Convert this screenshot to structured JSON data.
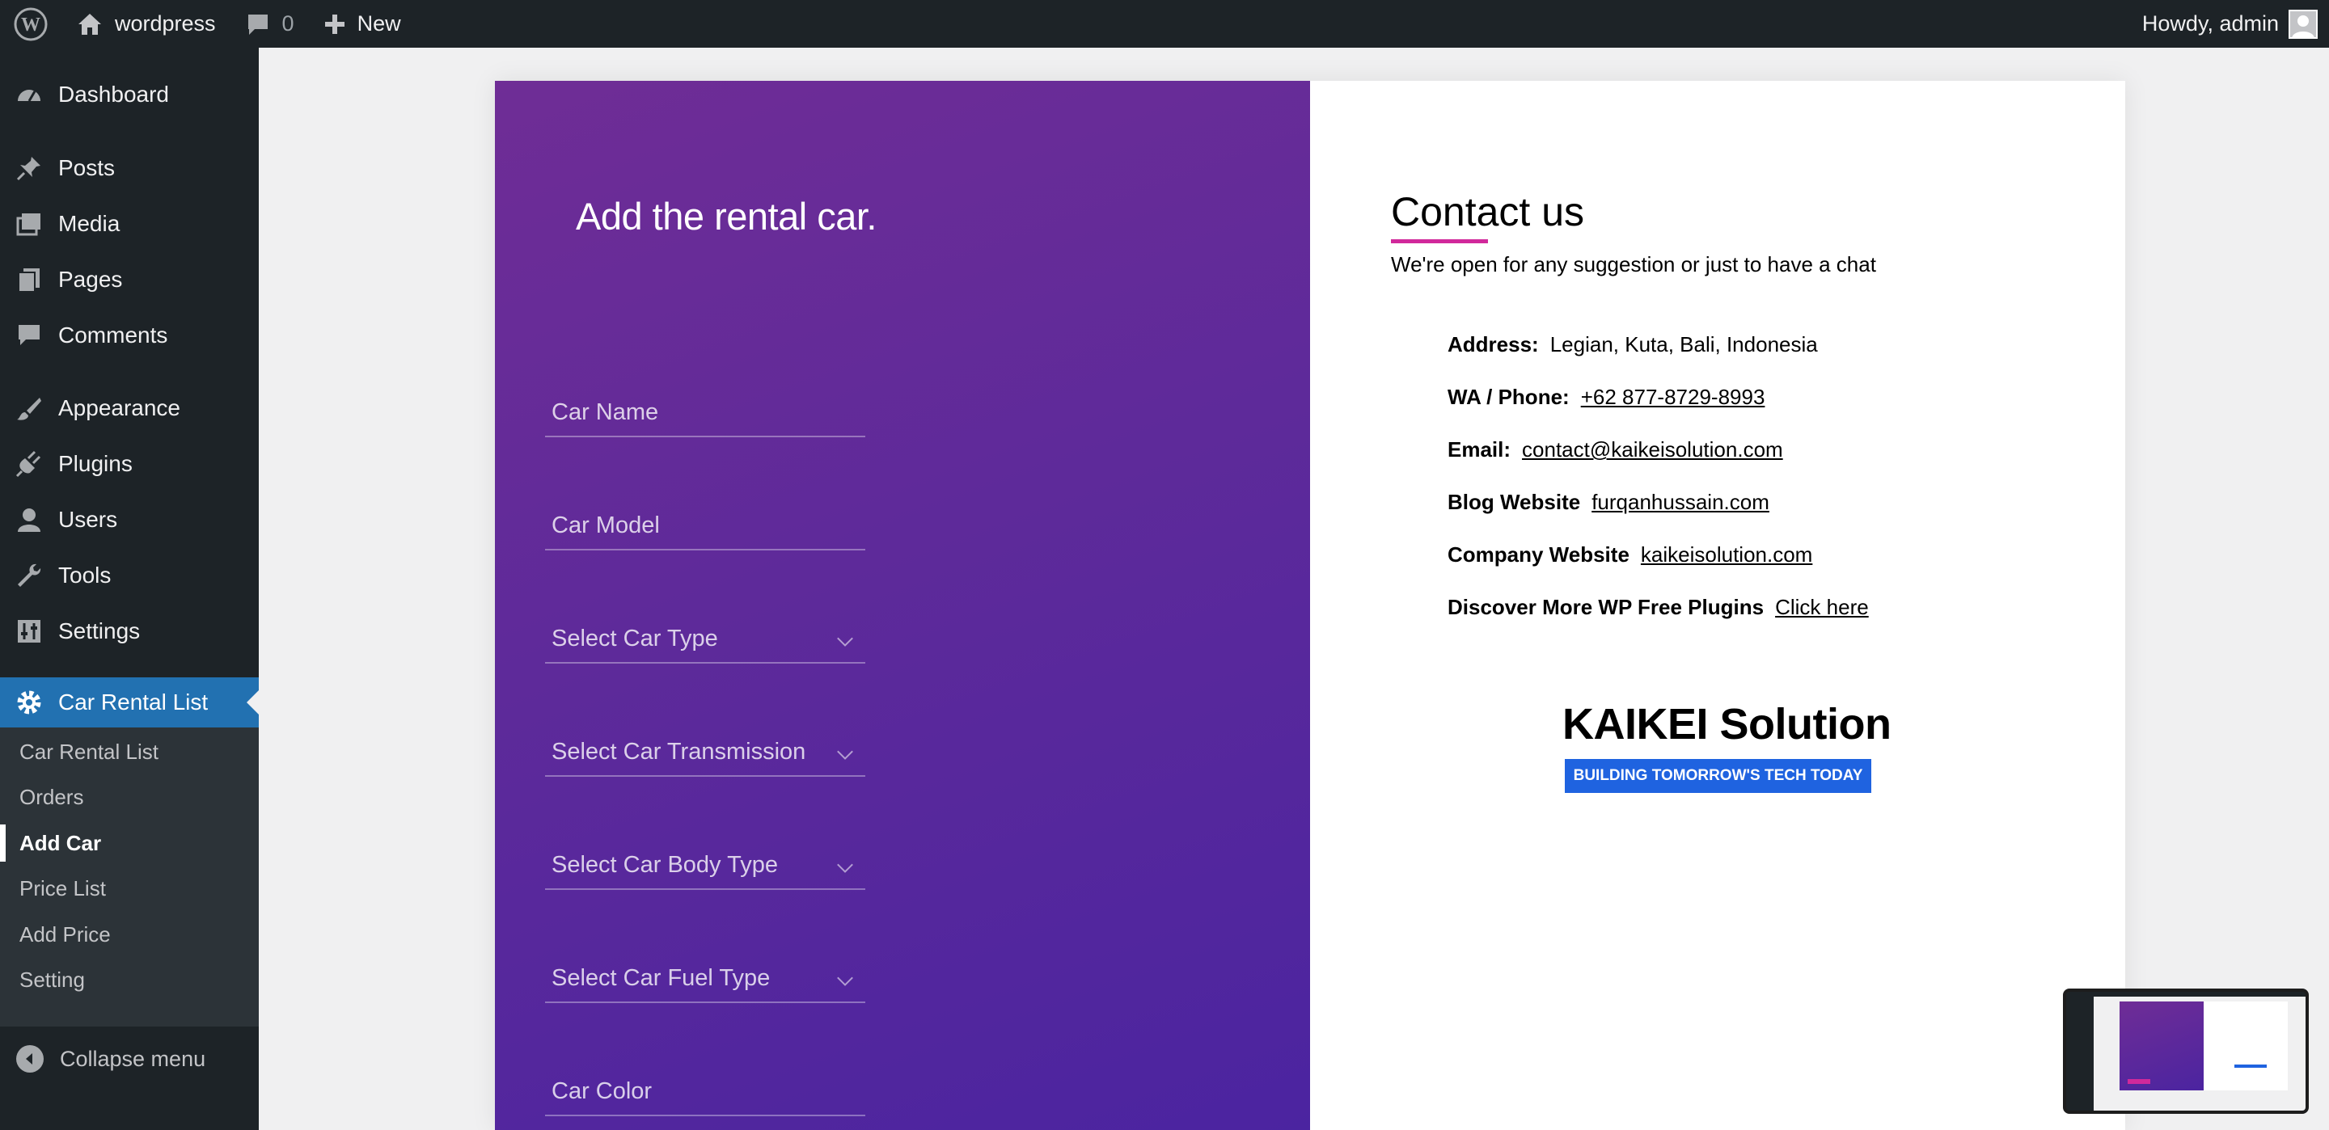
{
  "adminbar": {
    "site_name": "wordpress",
    "comments_count": "0",
    "new_label": "New",
    "howdy": "Howdy, admin"
  },
  "sidebar": {
    "items": [
      {
        "label": "Dashboard",
        "icon": "dashboard-icon"
      },
      {
        "label": "Posts",
        "icon": "pin-icon"
      },
      {
        "label": "Media",
        "icon": "media-icon"
      },
      {
        "label": "Pages",
        "icon": "pages-icon"
      },
      {
        "label": "Comments",
        "icon": "comment-icon"
      },
      {
        "label": "Appearance",
        "icon": "brush-icon"
      },
      {
        "label": "Plugins",
        "icon": "plug-icon"
      },
      {
        "label": "Users",
        "icon": "user-icon"
      },
      {
        "label": "Tools",
        "icon": "wrench-icon"
      },
      {
        "label": "Settings",
        "icon": "sliders-icon"
      },
      {
        "label": "Car Rental List",
        "icon": "gear-icon"
      }
    ],
    "submenu": [
      "Car Rental List",
      "Orders",
      "Add Car",
      "Price List",
      "Add Price",
      "Setting"
    ],
    "active_submenu": "Add Car",
    "collapse_label": "Collapse menu",
    "accent_color": "#2271b1"
  },
  "form": {
    "title": "Add the rental car.",
    "fields": [
      {
        "placeholder": "Car Name",
        "type": "text"
      },
      {
        "placeholder": "Car Model",
        "type": "text"
      },
      {
        "placeholder": "Select Car Type",
        "type": "select"
      },
      {
        "placeholder": "Select Car Transmission",
        "type": "select"
      },
      {
        "placeholder": "Select Car Body Type",
        "type": "select"
      },
      {
        "placeholder": "Select Car Fuel Type",
        "type": "select"
      },
      {
        "placeholder": "Car Color",
        "type": "text"
      }
    ],
    "panel_color_start": "#6f2d96",
    "panel_color_end": "#4b24a0"
  },
  "contact": {
    "title": "Contact us",
    "subtitle": "We're open for any suggestion or just to have a chat",
    "rows": [
      {
        "key": "Address:",
        "value": "Legian, Kuta, Bali, Indonesia"
      },
      {
        "key": "WA / Phone:",
        "value": "+62 877-8729-8993"
      },
      {
        "key": "Email:",
        "value": "contact@kaikeisolution.com"
      },
      {
        "key": "Blog Website",
        "value": "furqanhussain.com"
      },
      {
        "key": "Company Website",
        "value": "kaikeisolution.com"
      },
      {
        "key": "Discover More WP Free Plugins",
        "value": "Click here"
      }
    ],
    "brand_name": "KAIKEI Solution",
    "brand_tagline": "BUILDING TOMORROW'S TECH TODAY",
    "accent_color": "#d1299b",
    "tag_color": "#1f63e0"
  }
}
